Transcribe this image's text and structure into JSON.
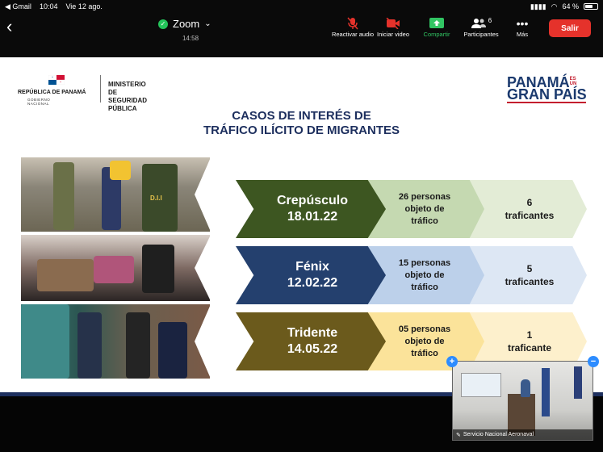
{
  "status": {
    "carrier": "◀ Gmail",
    "time": "10:04",
    "date": "Vie 12 ago.",
    "battery": "64 %",
    "battery_level": 0.64
  },
  "meeting": {
    "back": "‹",
    "title": "Zoom",
    "elapsed": "14:58",
    "toolbar": {
      "mute": "Reactivar audio",
      "video": "Iniciar video",
      "share": "Compartir",
      "participants": "Participantes",
      "participants_count": "6",
      "more": "Más",
      "leave": "Salir"
    }
  },
  "slide": {
    "org_left": "REPÚBLICA DE PANAMÁ",
    "org_left_sub": "GOBIERNO NACIONAL",
    "ministry_line1": "MINISTERIO DE",
    "ministry_line2": "SEGURIDAD PÚBLICA",
    "brand_line1": "PANAMÁ",
    "brand_es": "ES UN",
    "brand_line2": "GRAN PAÍS",
    "title_line1": "CASOS DE INTERÉS DE",
    "title_line2": "TRÁFICO ILÍCITO DE MIGRANTES",
    "cases": [
      {
        "name": "Crepúsculo",
        "date": "18.01.22",
        "persons_line1": "26 personas",
        "persons_line2": "objeto de",
        "persons_line3": "tráfico",
        "traffickers_line1": "6",
        "traffickers_line2": "traficantes",
        "color_main": "#3d5621",
        "color_mid": "#c5d9b1",
        "color_light": "#e3ecd6"
      },
      {
        "name": "Fénix",
        "date": "12.02.22",
        "persons_line1": "15 personas",
        "persons_line2": "objeto de",
        "persons_line3": "tráfico",
        "traffickers_line1": "5",
        "traffickers_line2": "traficantes",
        "color_main": "#24406e",
        "color_mid": "#bcd0ea",
        "color_light": "#dde7f4"
      },
      {
        "name": "Tridente",
        "date": "14.05.22",
        "persons_line1": "05 personas",
        "persons_line2": "objeto de",
        "persons_line3": "tráfico",
        "traffickers_line1": "1",
        "traffickers_line2": "traficante",
        "color_main": "#6b5a1c",
        "color_mid": "#fbe39a",
        "color_light": "#fdf0cc"
      }
    ],
    "photo_badge": "D.I.I"
  },
  "pip": {
    "name": "Servicio Nacional Aeronaval",
    "expand": "+",
    "collapse": "−"
  }
}
